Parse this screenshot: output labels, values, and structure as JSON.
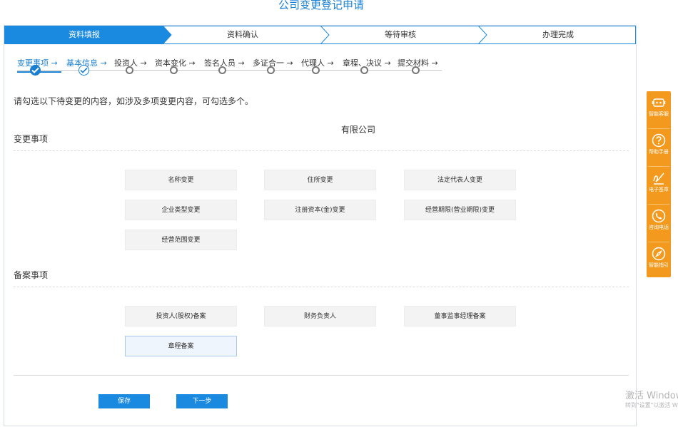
{
  "page_title": "公司变更登记申请",
  "main_steps": [
    {
      "label": "资料填报",
      "state": "active"
    },
    {
      "label": "资料确认",
      "state": "pending"
    },
    {
      "label": "等待审核",
      "state": "pending"
    },
    {
      "label": "办理完成",
      "state": "pending"
    }
  ],
  "sub_steps": [
    {
      "label": "变更事项",
      "state": "current"
    },
    {
      "label": "基本信息",
      "state": "done"
    },
    {
      "label": "投资人",
      "state": "todo"
    },
    {
      "label": "资本变化",
      "state": "todo"
    },
    {
      "label": "签名人员",
      "state": "todo"
    },
    {
      "label": "多证合一",
      "state": "todo"
    },
    {
      "label": "代理人",
      "state": "todo"
    },
    {
      "label": "章程、决议",
      "state": "todo"
    },
    {
      "label": "提交材料",
      "state": "todo"
    }
  ],
  "sub_step_arrow": "→",
  "instruction": "请勾选以下待变更的内容，如涉及多项变更内容，可勾选多个。",
  "company_type": "有限公司",
  "change_section": {
    "title": "变更事项",
    "options": [
      "名称变更",
      "住所变更",
      "法定代表人变更",
      "企业类型变更",
      "注册资本(金)变更",
      "经营期限(营业期限)变更",
      "经营范围变更"
    ]
  },
  "filing_section": {
    "title": "备案事项",
    "options": [
      "投资人(股权)备案",
      "财务负责人",
      "董事监事经理备案",
      "章程备案"
    ],
    "selected": "章程备案"
  },
  "buttons": {
    "save": "保存",
    "next": "下一步"
  },
  "sidebar": [
    {
      "label": "智能客服",
      "icon": "robot-icon"
    },
    {
      "label": "帮助手册",
      "icon": "help-icon"
    },
    {
      "label": "电子签章",
      "icon": "signature-icon"
    },
    {
      "label": "咨询电话",
      "icon": "phone-icon"
    },
    {
      "label": "智能指引",
      "icon": "compass-icon"
    }
  ],
  "watermark": {
    "line1": "激活 Windows",
    "line2": "转到\"设置\"以激活 Windows。"
  },
  "colors": {
    "accent": "#1a7fd0",
    "step_active": "#1a8ae0",
    "sidebar": "#f39a1e",
    "button": "#1a8ae0"
  }
}
